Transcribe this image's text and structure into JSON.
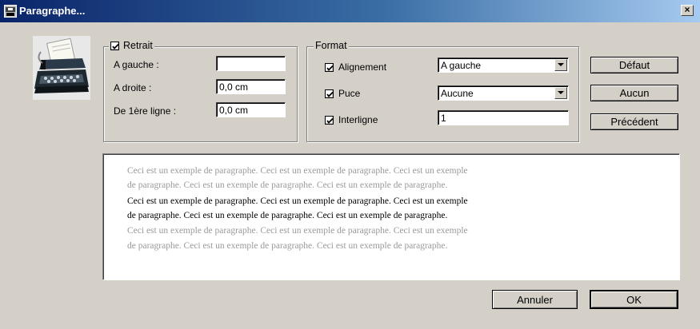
{
  "window": {
    "title": "Paragraphe...",
    "close_symbol": "×"
  },
  "retrait": {
    "label": "Retrait",
    "checked": true,
    "fields": [
      {
        "label": "A gauche :",
        "value": ""
      },
      {
        "label": "A droite :",
        "value": "0,0 cm"
      },
      {
        "label": "De 1ère ligne :",
        "value": "0,0 cm"
      }
    ]
  },
  "format": {
    "label": "Format",
    "rows": [
      {
        "label": "Alignement",
        "checked": true,
        "value": "A gauche"
      },
      {
        "label": "Puce",
        "checked": true,
        "value": "Aucune"
      },
      {
        "label": "Interligne",
        "checked": true,
        "value": "1"
      }
    ]
  },
  "side_buttons": {
    "default": "Défaut",
    "none": "Aucun",
    "previous": "Précédent"
  },
  "preview": {
    "lines": [
      {
        "text": "Ceci est un exemple de paragraphe. Ceci est un exemple de paragraphe. Ceci est un exemple",
        "style": "grey"
      },
      {
        "text": "de paragraphe. Ceci est un exemple de paragraphe. Ceci est un exemple de paragraphe.",
        "style": "grey"
      },
      {
        "text": "Ceci est un exemple de paragraphe. Ceci est un exemple de paragraphe. Ceci est un exemple",
        "style": "dark"
      },
      {
        "text": "de paragraphe. Ceci est un exemple de paragraphe. Ceci est un exemple de paragraphe.",
        "style": "dark"
      },
      {
        "text": "Ceci est un exemple de paragraphe. Ceci est un exemple de paragraphe. Ceci est un exemple",
        "style": "grey"
      },
      {
        "text": "de paragraphe. Ceci est un exemple de paragraphe. Ceci est un exemple de paragraphe.",
        "style": "grey"
      }
    ]
  },
  "footer": {
    "cancel": "Annuler",
    "ok": "OK"
  },
  "colors": {
    "title_start": "#0a246a",
    "title_end": "#a6caf0",
    "face": "#d4d0c8",
    "preview_grey": "#9a9a9a"
  }
}
